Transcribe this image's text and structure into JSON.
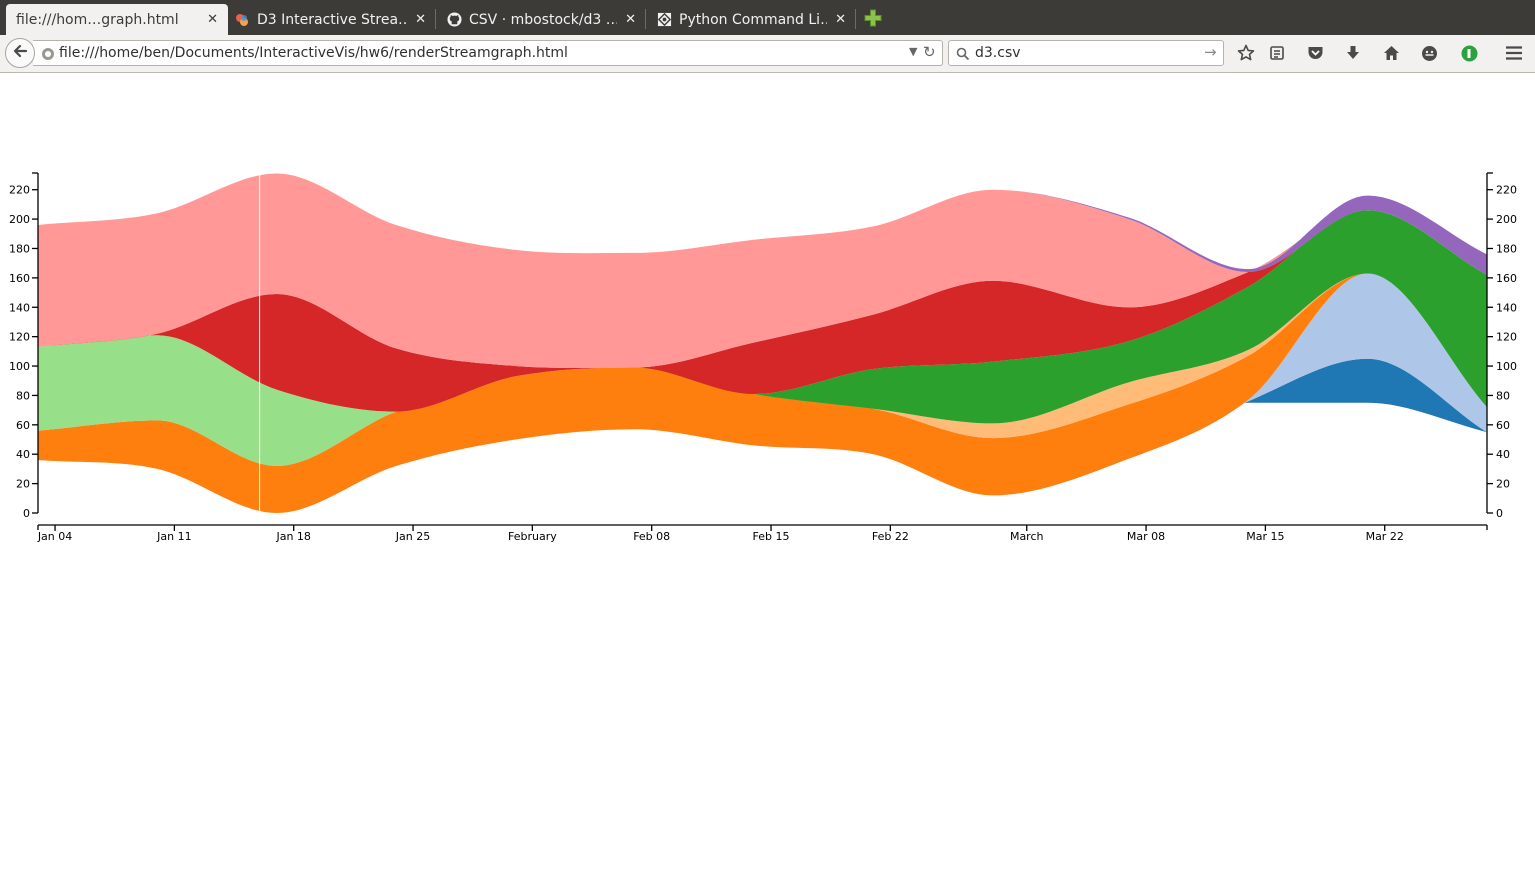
{
  "browser": {
    "tabs": [
      {
        "title": "file:///hom…graph.html",
        "active": true,
        "icon": "page-icon"
      },
      {
        "title": "D3 Interactive Strea…",
        "active": false,
        "icon": "d3-icon"
      },
      {
        "title": "CSV · mbostock/d3 …",
        "active": false,
        "icon": "github-icon"
      },
      {
        "title": "Python Command Li…",
        "active": false,
        "icon": "python-docs-icon"
      }
    ],
    "url": "file:///home/ben/Documents/InteractiveVis/hw6/renderStreamgraph.html",
    "search_value": "d3.csv",
    "toolbar_icons": [
      "bookmark-star-icon",
      "reading-list-icon",
      "pocket-icon",
      "download-icon",
      "home-icon",
      "emoji-icon",
      "extension-icon",
      "menu-icon"
    ]
  },
  "colors": {
    "tabbar_bg": "#3c3b37",
    "toolbar_bg": "#f2f1f0"
  },
  "chart_data": {
    "type": "area",
    "subtype": "streamgraph",
    "x_ticks": [
      "Jan 04",
      "Jan 11",
      "Jan 18",
      "Jan 25",
      "February",
      "Feb 08",
      "Feb 15",
      "Feb 22",
      "March",
      "Mar 08",
      "Mar 15",
      "Mar 22"
    ],
    "y_ticks": [
      0,
      20,
      40,
      60,
      80,
      100,
      120,
      140,
      160,
      180,
      200,
      220
    ],
    "ylim": [
      0,
      230
    ],
    "xlim": [
      "Jan 03",
      "Mar 28"
    ],
    "gridlines": false,
    "hover_line_date": "Jan 16",
    "x": [
      "Jan 03",
      "Jan 10",
      "Jan 17",
      "Jan 24",
      "Jan 31",
      "Feb 07",
      "Feb 14",
      "Feb 21",
      "Feb 28",
      "Mar 07",
      "Mar 14",
      "Mar 21",
      "Mar 28"
    ],
    "baseline": [
      36,
      30,
      0,
      32,
      50,
      57,
      46,
      40,
      12,
      37,
      75,
      75,
      55
    ],
    "series": [
      {
        "color": "#1f77b4",
        "values": [
          0,
          0,
          0,
          0,
          0,
          0,
          0,
          0,
          0,
          0,
          1,
          30,
          0
        ]
      },
      {
        "color": "#aec7e8",
        "values": [
          0,
          0,
          0,
          0,
          0,
          0,
          0,
          0,
          0,
          0,
          1,
          58,
          17
        ]
      },
      {
        "color": "#ff7f0e",
        "values": [
          20,
          33,
          32,
          37,
          43,
          42,
          35,
          31,
          39,
          37,
          30,
          0,
          0
        ]
      },
      {
        "color": "#ffbb78",
        "values": [
          0,
          0,
          0,
          0,
          0,
          0,
          0,
          0,
          10,
          15,
          4,
          0,
          0
        ]
      },
      {
        "color": "#2ca02c",
        "values": [
          0,
          0,
          0,
          0,
          0,
          0,
          0,
          27,
          42,
          28,
          43,
          43,
          90
        ]
      },
      {
        "color": "#98df8a",
        "values": [
          57,
          58,
          52,
          0,
          0,
          0,
          0,
          0,
          0,
          0,
          0,
          0,
          0
        ]
      },
      {
        "color": "#d62728",
        "values": [
          0,
          1,
          65,
          43,
          7,
          0,
          35,
          37,
          55,
          23,
          10,
          0,
          0
        ]
      },
      {
        "color": "#ff9896",
        "values": [
          83,
          82,
          82,
          84,
          79,
          78,
          70,
          60,
          62,
          60,
          0,
          0,
          0
        ]
      },
      {
        "color": "#9467bd",
        "values": [
          0,
          0,
          0,
          0,
          0,
          0,
          0,
          0,
          0,
          1,
          2,
          10,
          14
        ]
      }
    ]
  }
}
